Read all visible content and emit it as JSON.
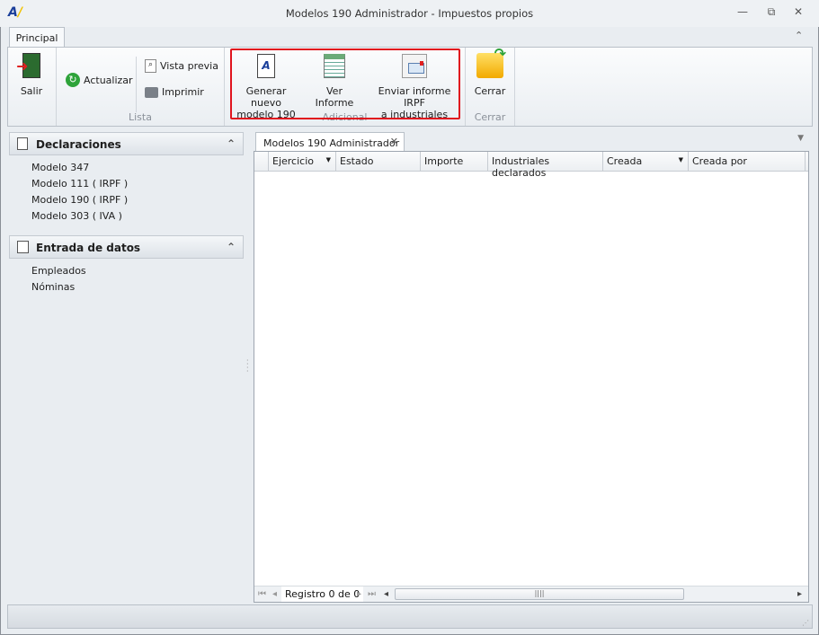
{
  "window": {
    "title": "Modelos 190 Administrador - Impuestos propios"
  },
  "ribbon": {
    "tab": "Principal",
    "salir": "Salir",
    "actualizar": "Actualizar",
    "vista_previa": "Vista previa",
    "imprimir": "Imprimir",
    "lista_group": "Lista",
    "generar_l1": "Generar nuevo",
    "generar_l2": "modelo 190",
    "ver_informe": "Ver Informe",
    "enviar_l1": "Enviar informe IRPF",
    "enviar_l2": "a industriales",
    "adicional_group": "Adicional",
    "cerrar": "Cerrar",
    "cerrar_group": "Cerrar"
  },
  "sidebar": {
    "declaraciones": {
      "title": "Declaraciones",
      "items": [
        "Modelo 347",
        "Modelo 111 ( IRPF )",
        "Modelo 190 ( IRPF )",
        "Modelo 303 ( IVA )"
      ]
    },
    "entrada": {
      "title": "Entrada de datos",
      "items": [
        "Empleados",
        "Nóminas"
      ]
    }
  },
  "document_tab": "Modelos 190 Administrador",
  "grid": {
    "columns": [
      "Ejercicio",
      "Estado",
      "Importe",
      "Industriales declarados",
      "Creada",
      "Creada por"
    ],
    "rows": [],
    "record_label": "Registro 0 de 0"
  },
  "colors": {
    "highlight": "#e0141e"
  }
}
